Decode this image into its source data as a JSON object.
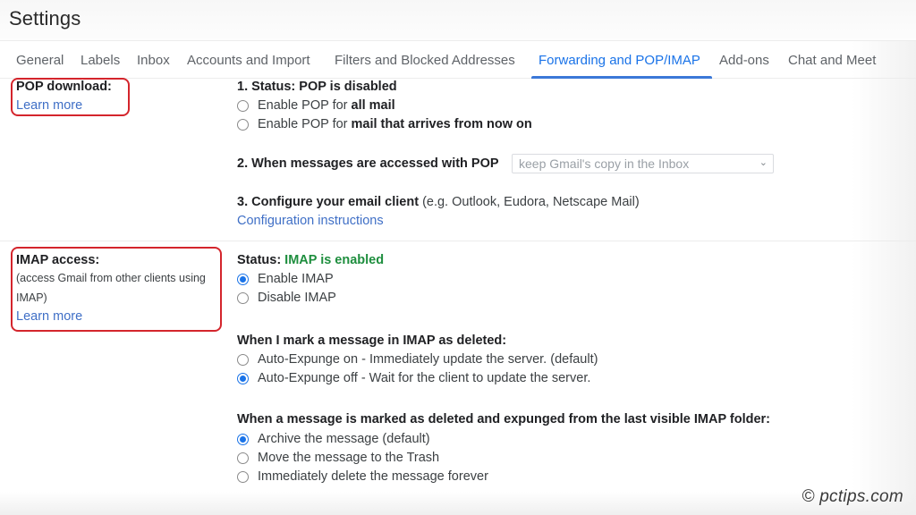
{
  "header": {
    "title": "Settings"
  },
  "tabs": [
    {
      "label": "General",
      "active": false
    },
    {
      "label": "Labels",
      "active": false
    },
    {
      "label": "Inbox",
      "active": false
    },
    {
      "label": "Accounts and Import",
      "active": false
    },
    {
      "label": "Filters and Blocked Addresses",
      "active": false
    },
    {
      "label": "Forwarding and POP/IMAP",
      "active": true
    },
    {
      "label": "Add-ons",
      "active": false
    },
    {
      "label": "Chat and Meet",
      "active": false
    }
  ],
  "pop": {
    "label": "POP download:",
    "learn_more": "Learn more",
    "status_prefix": "1. Status: POP is disabled",
    "options": [
      {
        "prefix": "Enable POP for ",
        "bold": "all mail",
        "checked": false
      },
      {
        "prefix": "Enable POP for ",
        "bold": "mail that arrives from now on",
        "checked": false
      }
    ],
    "access_label": "2. When messages are accessed with POP",
    "access_select": "keep Gmail's copy in the Inbox",
    "configure_bold": "3. Configure your email client",
    "configure_rest": " (e.g. Outlook, Eudora, Netscape Mail)",
    "config_link": "Configuration instructions"
  },
  "imap": {
    "label": "IMAP access:",
    "desc_line1": "(access Gmail from other clients using",
    "desc_line2": "IMAP)",
    "learn_more": "Learn more",
    "status_label": "Status: ",
    "status_value": "IMAP is enabled",
    "status_color": "#1e8e3e",
    "options": [
      {
        "label": "Enable IMAP",
        "checked": true
      },
      {
        "label": "Disable IMAP",
        "checked": false
      }
    ],
    "deleted_heading": "When I mark a message in IMAP as deleted:",
    "deleted_options": [
      {
        "label": "Auto-Expunge on - Immediately update the server. (default)",
        "checked": false
      },
      {
        "label": "Auto-Expunge off - Wait for the client to update the server.",
        "checked": true
      }
    ],
    "expunged_heading": "When a message is marked as deleted and expunged from the last visible IMAP folder:",
    "expunged_options": [
      {
        "label": "Archive the message (default)",
        "checked": true
      },
      {
        "label": "Move the message to the Trash",
        "checked": false
      },
      {
        "label": "Immediately delete the message forever",
        "checked": false
      }
    ]
  },
  "colors": {
    "accent": "#1a73e8",
    "link": "#3f6fc6",
    "highlight": "#d4252c"
  },
  "watermark": "© pctips.com"
}
